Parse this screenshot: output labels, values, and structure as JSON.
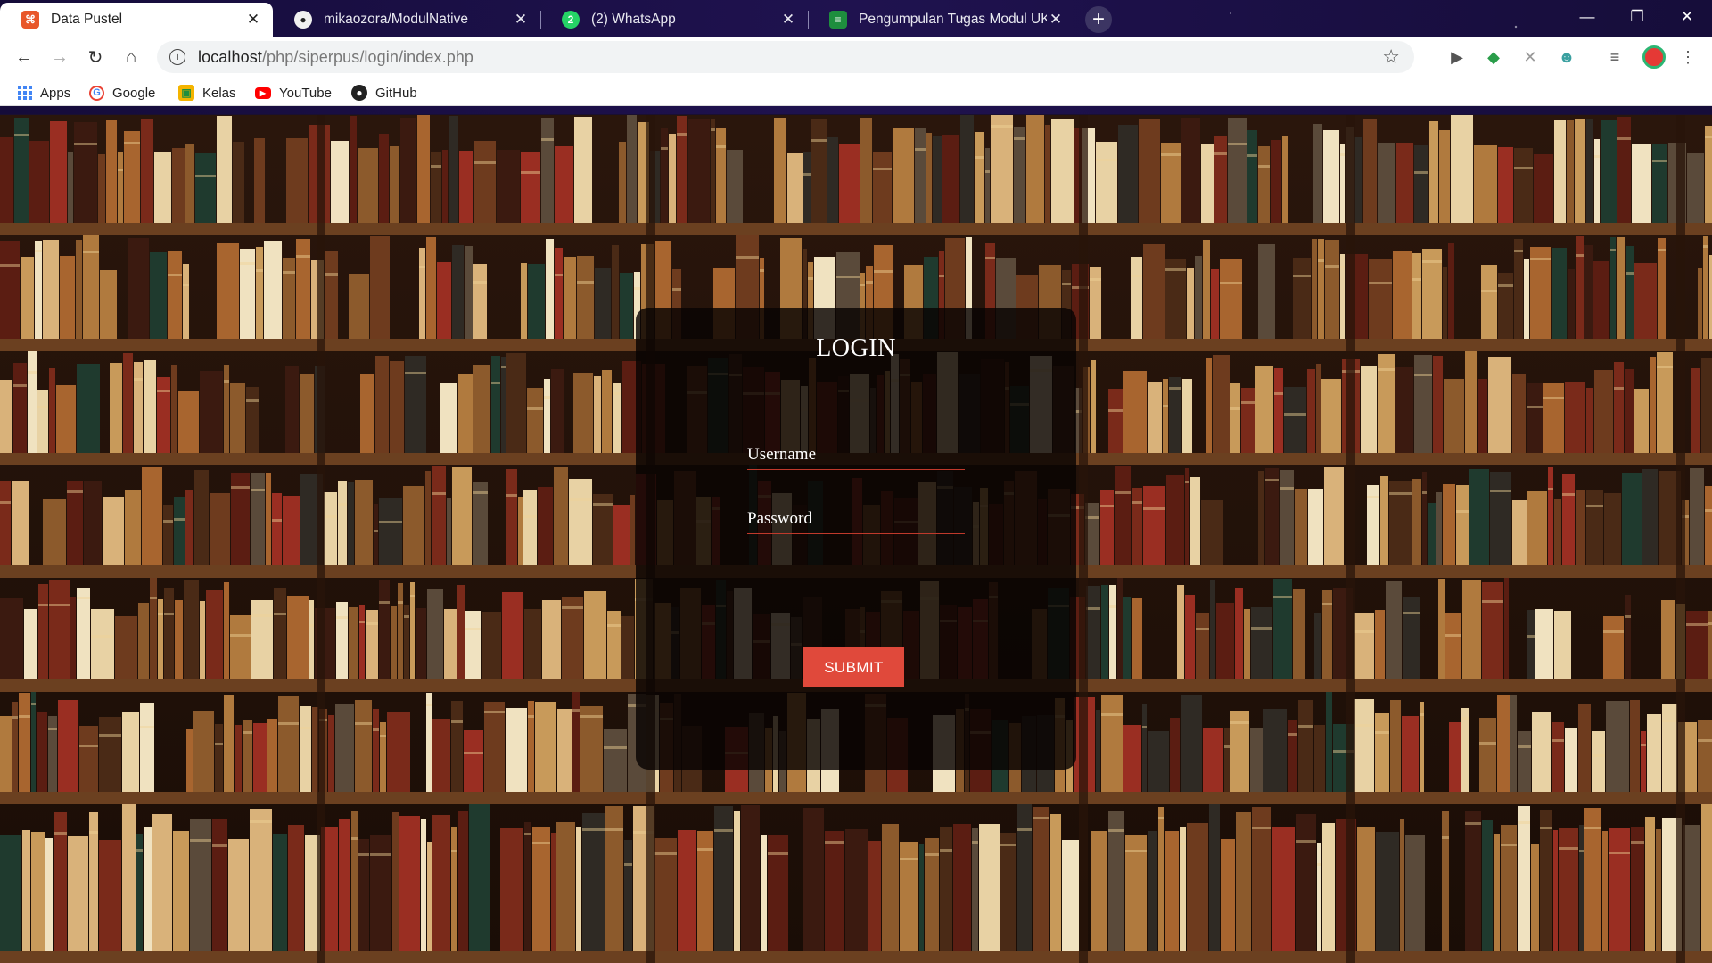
{
  "browser": {
    "tabs": [
      {
        "title": "Data Pustel",
        "active": true,
        "favicon": "siperpus-icon",
        "favicon_color": "#e8572a"
      },
      {
        "title": "mikaozora/ModulNative",
        "active": false,
        "favicon": "github-icon",
        "favicon_color": "#222222"
      },
      {
        "title": "(2) WhatsApp",
        "active": false,
        "favicon": "whatsapp-icon",
        "favicon_color": "#25d366"
      },
      {
        "title": "Pengumpulan Tugas Modul UKL",
        "active": false,
        "favicon": "google-forms-icon",
        "favicon_color": "#1e8e3e"
      }
    ],
    "address": {
      "host": "localhost",
      "path": "/php/siperpus/login/index.php"
    },
    "bookmarks": [
      {
        "label": "Apps",
        "icon": "apps-grid-icon"
      },
      {
        "label": "Google",
        "icon": "google-icon"
      },
      {
        "label": "Kelas",
        "icon": "classroom-icon"
      },
      {
        "label": "YouTube",
        "icon": "youtube-icon"
      },
      {
        "label": "GitHub",
        "icon": "github-icon"
      }
    ]
  },
  "login": {
    "title": "LOGIN",
    "username_placeholder": "Username",
    "password_placeholder": "Password",
    "submit_label": "SUBMIT"
  },
  "colors": {
    "submit_bg": "#e0493b",
    "field_underline": "#c0392b",
    "card_bg": "rgba(8,4,3,0.82)"
  }
}
